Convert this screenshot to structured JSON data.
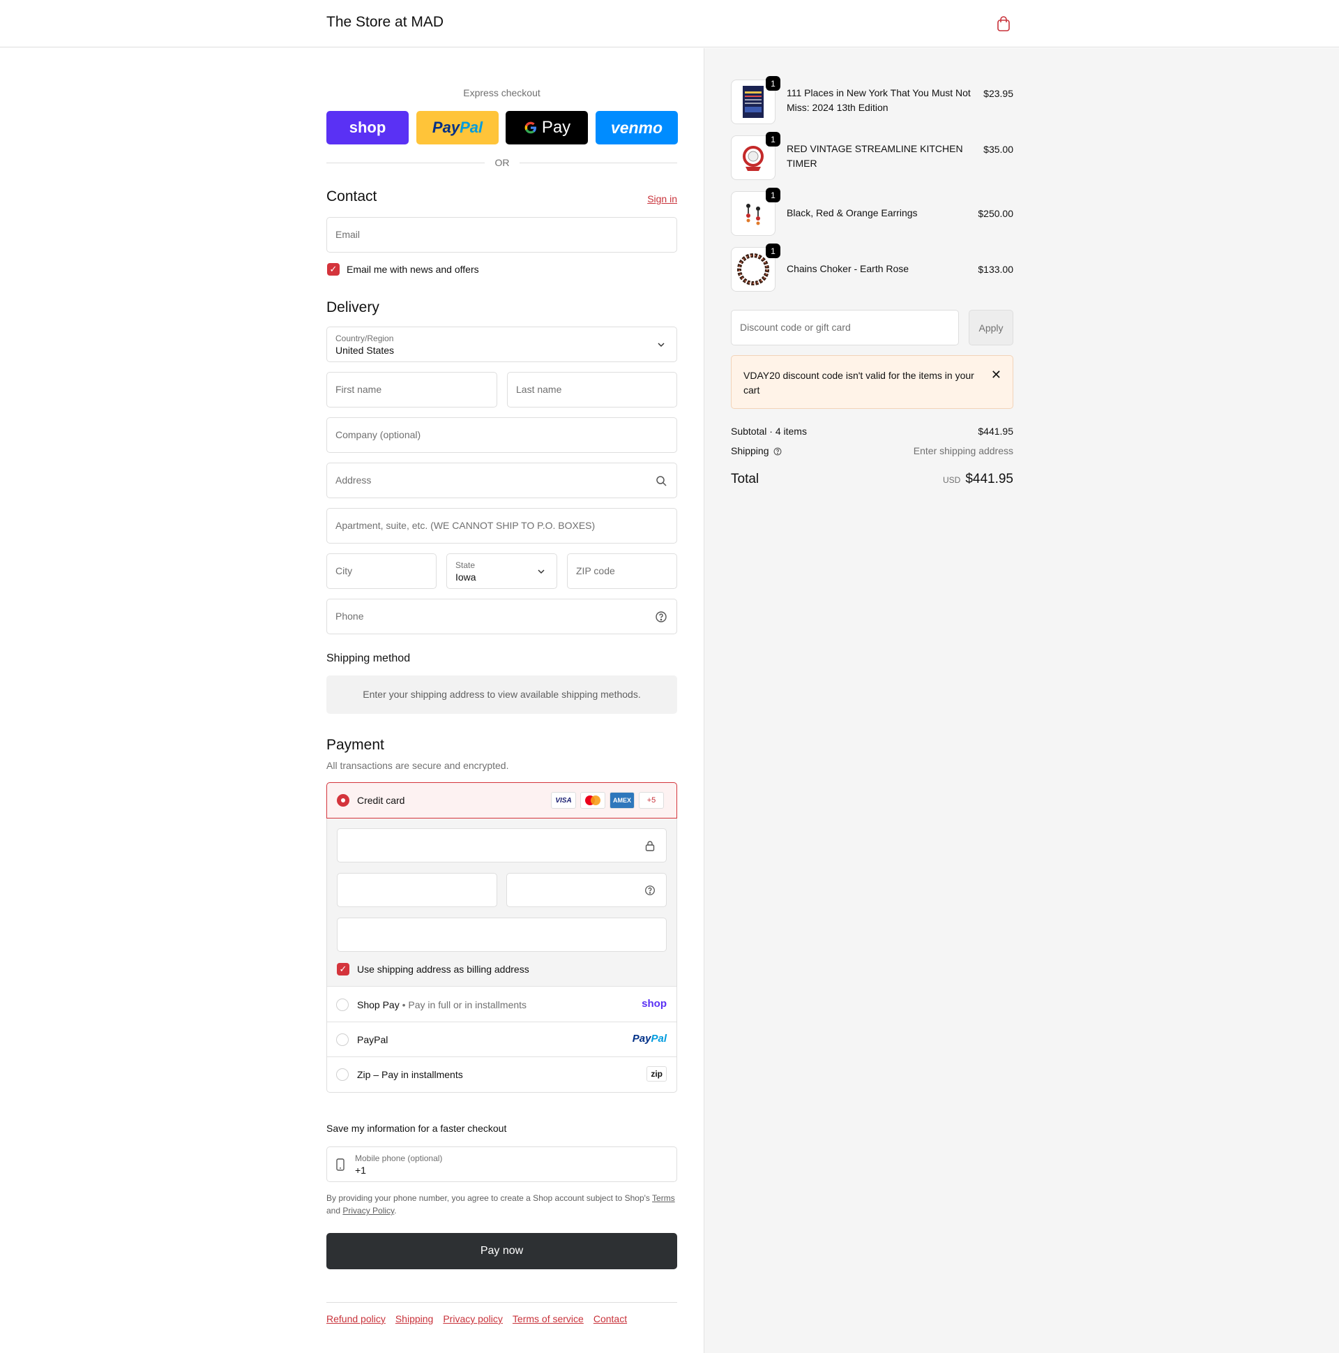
{
  "header": {
    "store_name": "The Store at MAD"
  },
  "express": {
    "title": "Express checkout",
    "shop_label": "shop",
    "paypal_pay": "Pay",
    "paypal_pal": "Pal",
    "gpay_label": "Pay",
    "venmo_label": "venmo",
    "or_label": "OR"
  },
  "contact": {
    "title": "Contact",
    "sign_in": "Sign in",
    "email_placeholder": "Email",
    "news_label": "Email me with news and offers"
  },
  "delivery": {
    "title": "Delivery",
    "country_label": "Country/Region",
    "country_value": "United States",
    "first_name": "First name",
    "last_name": "Last name",
    "company": "Company (optional)",
    "address": "Address",
    "apartment": "Apartment, suite, etc. (WE CANNOT SHIP TO P.O. BOXES)",
    "city": "City",
    "state_label": "State",
    "state_value": "Iowa",
    "zip": "ZIP code",
    "phone": "Phone"
  },
  "shipping_method": {
    "title": "Shipping method",
    "message": "Enter your shipping address to view available shipping methods."
  },
  "payment": {
    "title": "Payment",
    "subtitle": "All transactions are secure and encrypted.",
    "credit_card": "Credit card",
    "card_logos": [
      "VISA",
      "AMEX",
      "+5"
    ],
    "billing_label": "Use shipping address as billing address",
    "shop_pay": "Shop Pay",
    "shop_pay_sub": "Pay in full or in installments",
    "shop_logo": "shop",
    "paypal": "PayPal",
    "paypal_logo_pay": "Pay",
    "paypal_logo_pal": "Pal",
    "zip": "Zip – Pay in installments",
    "zip_logo": "zip"
  },
  "save_info": {
    "title": "Save my information for a faster checkout",
    "phone_label": "Mobile phone (optional)",
    "phone_value": "+1",
    "legal_1": "By providing your phone number, you agree to create a Shop account subject to Shop's",
    "terms": "Terms",
    "legal_and": "and",
    "privacy": "Privacy Policy",
    "legal_end": "."
  },
  "pay_now": "Pay now",
  "footer": {
    "links": [
      "Refund policy",
      "Shipping",
      "Privacy policy",
      "Terms of service",
      "Contact"
    ]
  },
  "cart": {
    "items": [
      {
        "name": "111 Places in New York That You Must Not Miss: 2024 13th Edition",
        "price": "$23.95",
        "qty": "1"
      },
      {
        "name": "RED VINTAGE STREAMLINE KITCHEN TIMER",
        "price": "$35.00",
        "qty": "1"
      },
      {
        "name": "Black, Red & Orange Earrings",
        "price": "$250.00",
        "qty": "1"
      },
      {
        "name": "Chains Choker - Earth Rose",
        "price": "$133.00",
        "qty": "1"
      }
    ],
    "discount_placeholder": "Discount code or gift card",
    "apply": "Apply",
    "alert": "VDAY20 discount code isn't valid for the items in your cart",
    "subtotal_label": "Subtotal · 4 items",
    "subtotal": "$441.95",
    "shipping_label": "Shipping",
    "shipping_value": "Enter shipping address",
    "total_label": "Total",
    "currency": "USD",
    "total": "$441.95"
  },
  "colors": {
    "accent": "#d4343c",
    "button_dark": "#2d3033",
    "shop_purple": "#5a31f4",
    "paypal_yellow": "#ffc439",
    "venmo_blue": "#008cff"
  }
}
